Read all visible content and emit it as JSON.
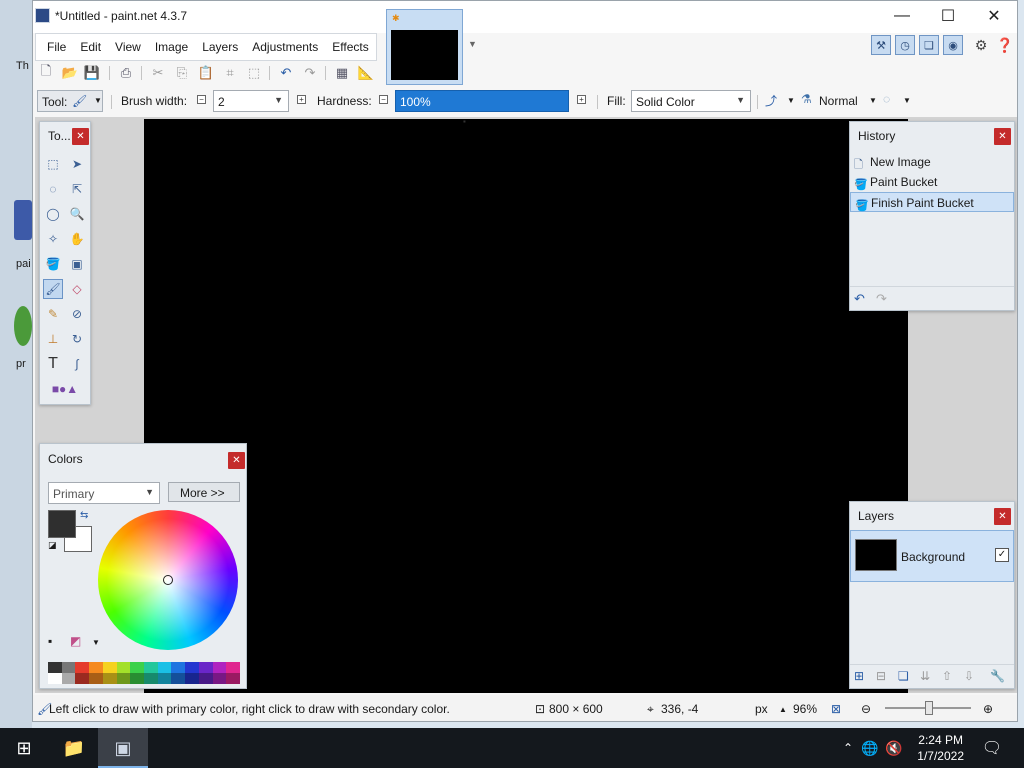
{
  "desktop": {
    "labels": [
      "Th",
      "pai",
      "pr"
    ]
  },
  "window": {
    "title": "*Untitled - paint.net 4.3.7",
    "minimize_glyph": "—",
    "maximize_glyph": "☐",
    "close_glyph": "✕"
  },
  "menu": {
    "items": [
      "File",
      "Edit",
      "View",
      "Image",
      "Layers",
      "Adjustments",
      "Effects"
    ]
  },
  "toolbar": {
    "tool_label": "Tool:",
    "brush_width_label": "Brush width:",
    "brush_width_value": "2",
    "hardness_label": "Hardness:",
    "hardness_value": "100%",
    "fill_label": "Fill:",
    "fill_value": "Solid Color",
    "blend_value": "Normal"
  },
  "tools_panel": {
    "title": "To..."
  },
  "history_panel": {
    "title": "History",
    "items": [
      "New Image",
      "Paint Bucket",
      "Finish Paint Bucket"
    ]
  },
  "colors_panel": {
    "title": "Colors",
    "mode_value": "Primary",
    "more_label": "More >>",
    "primary_color": "#2f2f2f",
    "secondary_color": "#ffffff"
  },
  "layers_panel": {
    "title": "Layers",
    "layer_name": "Background"
  },
  "statusbar": {
    "hint": "Left click to draw with primary color, right click to draw with secondary color.",
    "image_size": "800 × 600",
    "cursor_pos": "336, -4",
    "units": "px",
    "zoom": "96%"
  },
  "taskbar": {
    "time": "2:24 PM",
    "date": "1/7/2022"
  }
}
